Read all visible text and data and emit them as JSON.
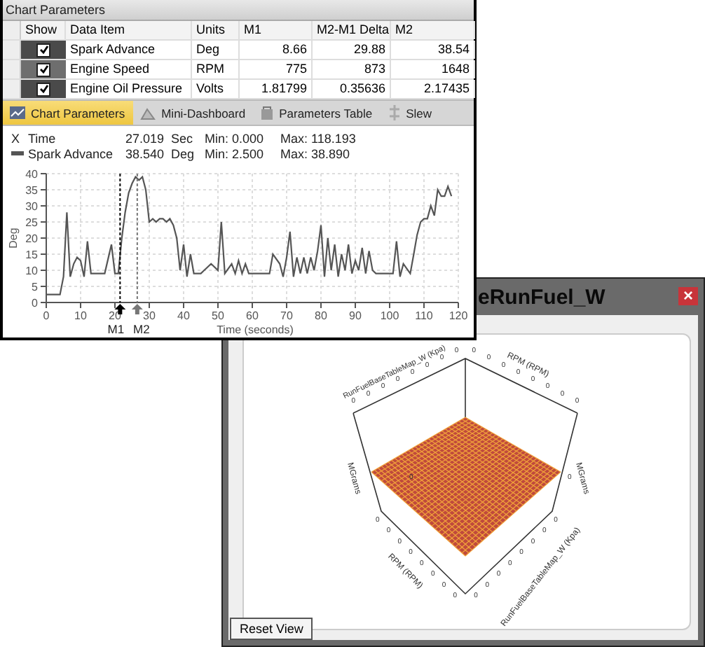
{
  "plot_window": {
    "title": "eRunFuel_W",
    "close_label": "×",
    "reset_button": "Reset View",
    "axes": [
      {
        "label": "RunFuelBaseTableMap_W (Kpa)",
        "ticks": [
          "0",
          "0",
          "0",
          "0",
          "0",
          "0",
          "0",
          "0"
        ]
      },
      {
        "label": "RPM (RPM)",
        "ticks": [
          "0",
          "0",
          "0",
          "0",
          "0",
          "0",
          "0",
          "0"
        ]
      },
      {
        "label": "RPM (RPM)",
        "ticks": [
          "0",
          "0",
          "0",
          "0",
          "0",
          "0",
          "0",
          "0"
        ]
      },
      {
        "label": "RunFuelBaseTableMap_W (Kpa)",
        "ticks": [
          "0",
          "0",
          "0",
          "0",
          "0",
          "0",
          "0",
          "0"
        ]
      }
    ],
    "z_axes": [
      {
        "label": "MGrams",
        "tick": "0"
      },
      {
        "label": "MGrams",
        "tick": "0"
      }
    ]
  },
  "chart_window": {
    "title": "Chart Parameters",
    "table": {
      "show_column": "Show",
      "columns": [
        "Data Item",
        "Units",
        "M1",
        "M2-M1 Delta",
        "M2"
      ],
      "rows": [
        {
          "color": "#4a4a4a",
          "checked": true,
          "cells": [
            "Spark Advance",
            "Deg",
            "8.66",
            "29.88",
            "38.54"
          ]
        },
        {
          "color": "#6e6e6e",
          "checked": true,
          "cells": [
            "Engine Speed",
            "RPM",
            "775",
            "873",
            "1648"
          ]
        },
        {
          "color": "#4a4a4a",
          "checked": true,
          "cells": [
            "Engine Oil Pressure",
            "Volts",
            "1.81799",
            "0.35636",
            "2.17435"
          ]
        }
      ]
    },
    "tabs": [
      {
        "label": "Chart Parameters",
        "selected": true
      },
      {
        "label": "Mini-Dashboard",
        "selected": false
      },
      {
        "label": "Parameters Table",
        "selected": false
      },
      {
        "label": "Slew",
        "selected": false
      }
    ],
    "legend": [
      {
        "kind": "x-axis",
        "marker": "X",
        "name": "Time",
        "value": "27.019",
        "unit": "Sec",
        "min": "Min: 0.000",
        "max": "Max: 118.193"
      },
      {
        "kind": "series",
        "value": "38.540",
        "unit": "Deg",
        "min": "Min: 2.500",
        "max": "Max: 38.890"
      }
    ],
    "chart_data": {
      "type": "line",
      "grid": true,
      "xlabel": "Time (seconds)",
      "ylabel": "Deg",
      "xlim": [
        0,
        120
      ],
      "ylim": [
        0,
        40
      ],
      "ref_lines": [
        {
          "axis": "x",
          "value": 21.5,
          "label": "M1",
          "color": "#000000"
        },
        {
          "axis": "x",
          "value": 26.5,
          "label": "M2",
          "color": "#777777"
        }
      ],
      "xticks": [
        0,
        10,
        20,
        30,
        40,
        50,
        60,
        70,
        80,
        90,
        100,
        110,
        120
      ],
      "yticks": [
        0,
        5,
        10,
        15,
        20,
        25,
        30,
        35,
        40
      ],
      "x": [
        0,
        4,
        5,
        6,
        7,
        8,
        9,
        10,
        11,
        12,
        13,
        17,
        19,
        20,
        21,
        22,
        23,
        24,
        25,
        26,
        27,
        28,
        29,
        30,
        31,
        32,
        33,
        34,
        35,
        36,
        37,
        38,
        39,
        40,
        41,
        42,
        43,
        45,
        46,
        48,
        50,
        51,
        52,
        54,
        55,
        56,
        57,
        58,
        59,
        65,
        66,
        68,
        69,
        70,
        71,
        72,
        73,
        74,
        75,
        76,
        77,
        78,
        79,
        80,
        81,
        82,
        83,
        84,
        85,
        86,
        87,
        88,
        89,
        90,
        91,
        92,
        93,
        94,
        95,
        96,
        100,
        101,
        102,
        103,
        104,
        106,
        107,
        108,
        109,
        110,
        111,
        112,
        113,
        114,
        115,
        116,
        117,
        118
      ],
      "series": [
        {
          "name": "Spark Advance",
          "color": "#555555",
          "values": [
            2.5,
            2.5,
            8,
            28,
            8,
            12,
            14,
            13,
            8,
            19,
            9,
            9,
            18,
            9,
            9,
            20,
            28,
            34,
            37,
            39,
            38,
            39,
            35,
            25,
            26,
            25,
            26,
            26,
            25,
            26,
            24,
            20,
            10,
            18,
            8,
            15,
            9,
            9,
            10,
            12,
            10,
            25,
            9,
            12,
            9,
            13,
            9,
            12,
            9,
            9,
            15,
            12,
            8,
            14,
            22,
            8,
            14,
            9,
            14,
            9,
            14,
            10,
            16,
            24,
            8,
            20,
            10,
            18,
            8,
            15,
            10,
            18,
            9,
            13,
            10,
            17,
            9,
            16,
            10,
            9,
            9,
            9,
            19,
            8,
            12,
            9,
            15,
            21,
            25,
            26,
            26,
            30,
            27,
            35,
            33,
            33,
            36,
            33
          ]
        }
      ]
    }
  }
}
